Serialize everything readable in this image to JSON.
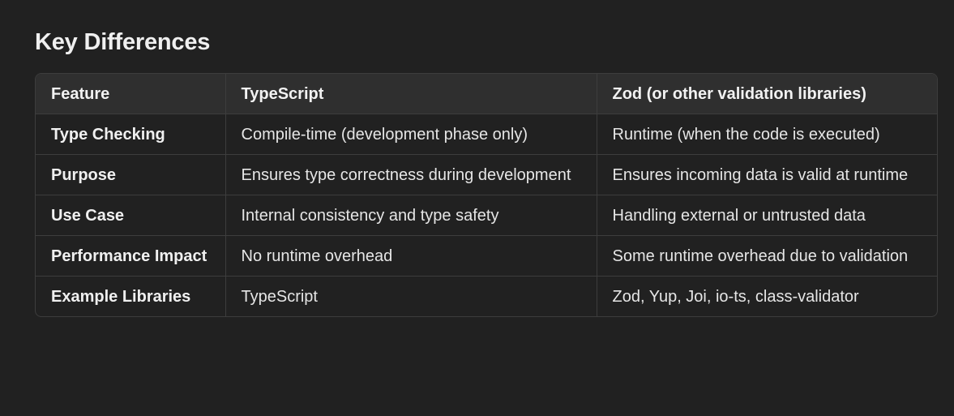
{
  "section": {
    "title": "Key Differences"
  },
  "table": {
    "headers": [
      "Feature",
      "TypeScript",
      "Zod (or other validation libraries)"
    ],
    "rows": [
      [
        "Type Checking",
        "Compile-time (development phase only)",
        "Runtime (when the code is executed)"
      ],
      [
        "Purpose",
        "Ensures type correctness during development",
        "Ensures incoming data is valid at runtime"
      ],
      [
        "Use Case",
        "Internal consistency and type safety",
        "Handling external or untrusted data"
      ],
      [
        "Performance Impact",
        "No runtime overhead",
        "Some runtime overhead due to validation"
      ],
      [
        "Example Libraries",
        "TypeScript",
        "Zod, Yup, Joi, io-ts, class-validator"
      ]
    ]
  },
  "colors": {
    "background": "#212121",
    "header_background": "#2f2f2f",
    "border": "#3d3d3d",
    "text": "#ececec"
  }
}
